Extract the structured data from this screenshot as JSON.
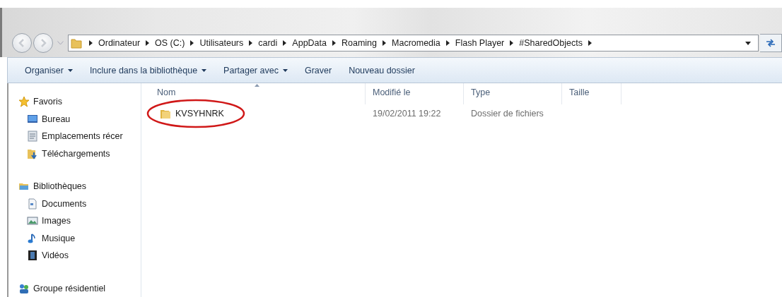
{
  "address_bar": {
    "breadcrumbs": [
      "Ordinateur",
      "OS (C:)",
      "Utilisateurs",
      "cardi",
      "AppData",
      "Roaming",
      "Macromedia",
      "Flash Player",
      "#SharedObjects"
    ]
  },
  "toolbar": [
    {
      "label": "Organiser",
      "has_menu": true
    },
    {
      "label": "Inclure dans la bibliothèque",
      "has_menu": true
    },
    {
      "label": "Partager avec",
      "has_menu": true
    },
    {
      "label": "Graver",
      "has_menu": false
    },
    {
      "label": "Nouveau dossier",
      "has_menu": false
    }
  ],
  "sidebar": {
    "groups": [
      {
        "label": "Favoris",
        "kind": "star",
        "children": [
          {
            "label": "Bureau",
            "kind": "desktop"
          },
          {
            "label": "Emplacements récer",
            "kind": "recent"
          },
          {
            "label": "Téléchargements",
            "kind": "downloads"
          }
        ]
      },
      {
        "label": "Bibliothèques",
        "kind": "library",
        "children": [
          {
            "label": "Documents",
            "kind": "document"
          },
          {
            "label": "Images",
            "kind": "picture"
          },
          {
            "label": "Musique",
            "kind": "music"
          },
          {
            "label": "Vidéos",
            "kind": "video"
          }
        ]
      },
      {
        "label": "Groupe résidentiel",
        "kind": "homegroup"
      }
    ]
  },
  "table": {
    "columns": [
      {
        "label": "Nom",
        "sorted": true
      },
      {
        "label": "Modifié le",
        "sorted": false
      },
      {
        "label": "Type",
        "sorted": false
      },
      {
        "label": "Taille",
        "sorted": false
      }
    ],
    "rows": [
      {
        "name": "KVSYHNRK",
        "modified": "19/02/2011 19:22",
        "type": "Dossier de fichiers",
        "circled": true
      }
    ]
  }
}
